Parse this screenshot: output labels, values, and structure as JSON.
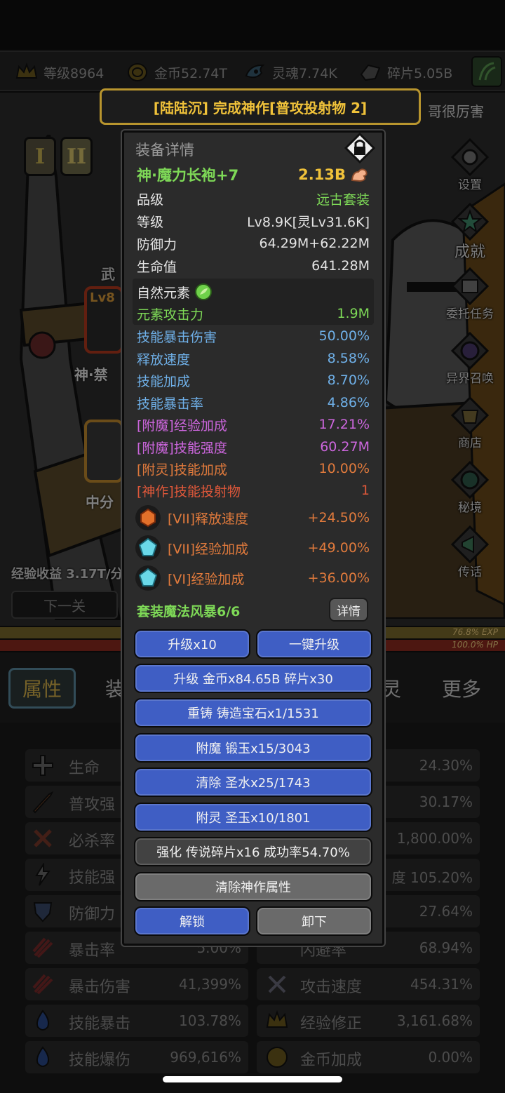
{
  "resources": [
    {
      "label": "等级8964",
      "icon": "crown-icon"
    },
    {
      "label": "金币52.74T",
      "icon": "coin-icon"
    },
    {
      "label": "灵魂7.74K",
      "icon": "soul-icon"
    },
    {
      "label": "碎片5.05B",
      "icon": "shard-icon"
    }
  ],
  "banner": {
    "text": "[陆陆沉] 完成神作[普攻投射物 2]",
    "right_text": "哥很厉害"
  },
  "tier_buttons": [
    "I",
    "II"
  ],
  "side_menu": [
    {
      "label": "设置",
      "icon": "gear-icon"
    },
    {
      "label": "成就",
      "icon": "star-icon"
    },
    {
      "label": "委托任务",
      "icon": "scroll-icon"
    },
    {
      "label": "异界召唤",
      "icon": "portal-icon"
    },
    {
      "label": "商店",
      "icon": "shop-icon"
    },
    {
      "label": "秘境",
      "icon": "secret-realm-icon"
    },
    {
      "label": "传话",
      "icon": "megaphone-icon"
    }
  ],
  "left_labels": {
    "weapon": "武",
    "lv": "Lv8",
    "sword_name": "神·禁",
    "score": "中分",
    "exp_income": "经验收益 3.17T/分",
    "next_level": "下一关"
  },
  "bars": {
    "exp": "76.8% EXP",
    "hp": "100.0% HP"
  },
  "tabs": {
    "active": "属性",
    "t2": "装",
    "t3": "灵",
    "more": "更多"
  },
  "stats": [
    {
      "label": "生命",
      "value": "24.30%",
      "icon": "cross-icon"
    },
    {
      "label": "普攻强",
      "value": "30.17%",
      "icon": "arrow-icon"
    },
    {
      "label": "必杀率",
      "value": "1,800.00%",
      "icon": "crit-icon"
    },
    {
      "label": "技能强",
      "value": "度 105.20%",
      "icon": "lightning-icon"
    },
    {
      "label": "防御力",
      "value": "27.64%",
      "icon": "shield-icon"
    },
    {
      "label": "暴击率",
      "value": "5.00%",
      "right_label": "闪避率",
      "right_value": "68.94%",
      "icon": "claw-icon"
    },
    {
      "label": "暴击伤害",
      "value": "41,399%",
      "right_label": "攻击速度",
      "right_value": "454.31%",
      "icon": "claw-icon"
    },
    {
      "label": "技能暴击",
      "value": "103.78%",
      "right_label": "经验修正",
      "right_value": "3,161.68%",
      "icon": "flame-icon"
    },
    {
      "label": "技能爆伤",
      "value": "969,616%",
      "right_label": "金币加成",
      "right_value": "0.00%",
      "icon": "flame-icon"
    }
  ],
  "panel": {
    "title": "装备详情",
    "item_name": "神·魔力长袍+7",
    "power": "2.13B",
    "rows": [
      {
        "k": "品级",
        "v": "远古套装"
      },
      {
        "k": "等级",
        "v": "Lv8.9K[灵Lv31.6K]"
      },
      {
        "k": "防御力",
        "v": "64.29M+62.22M"
      },
      {
        "k": "生命值",
        "v": "641.28M"
      }
    ],
    "element": {
      "name": "自然元素",
      "atk_label": "元素攻击力",
      "atk_value": "1.9M"
    },
    "skills": [
      {
        "k": "技能暴击伤害",
        "v": "50.00%"
      },
      {
        "k": "释放速度",
        "v": "8.58%"
      },
      {
        "k": "技能加成",
        "v": "8.70%"
      },
      {
        "k": "技能暴击率",
        "v": "4.86%"
      }
    ],
    "enchants": [
      {
        "k": "[附魔]经验加成",
        "v": "17.21%"
      },
      {
        "k": "[附魔]技能强度",
        "v": "60.27M"
      }
    ],
    "spirit": {
      "k": "[附灵]技能加成",
      "v": "10.00%"
    },
    "masterwork": {
      "k": "[神作]技能投射物",
      "v": "1"
    },
    "gems": [
      {
        "k": "[VII]释放速度",
        "v": "+24.50%",
        "icon": "orange-gem-icon"
      },
      {
        "k": "[VII]经验加成",
        "v": "+49.00%",
        "icon": "cyan-gem-icon"
      },
      {
        "k": "[VI]经验加成",
        "v": "+36.00%",
        "icon": "cyan-gem-icon"
      }
    ],
    "set": {
      "label": "套装魔法风暴6/6",
      "detail": "详情"
    },
    "buttons": {
      "upgrade10": "升级x10",
      "one_key": "一键升级",
      "upgrade": "升级 金币x84.65B 碎片x30",
      "reforge": "重铸 铸造宝石x1/1531",
      "enchant": "附魔 锻玉x15/3043",
      "clear": "清除 圣水x25/1743",
      "spirit": "附灵 圣玉x10/1801",
      "strengthen": "强化 传说碎片x16 成功率54.70%",
      "clear_master": "清除神作属性",
      "unlock": "解锁",
      "unequip": "卸下"
    }
  },
  "colors": {
    "green": "#7ed957",
    "blue_val": "#6fb0e8",
    "purple": "#cc66dd",
    "orange": "#e07a3c",
    "gold": "#f0c23a",
    "btn_blue": "#3f5ec4"
  }
}
